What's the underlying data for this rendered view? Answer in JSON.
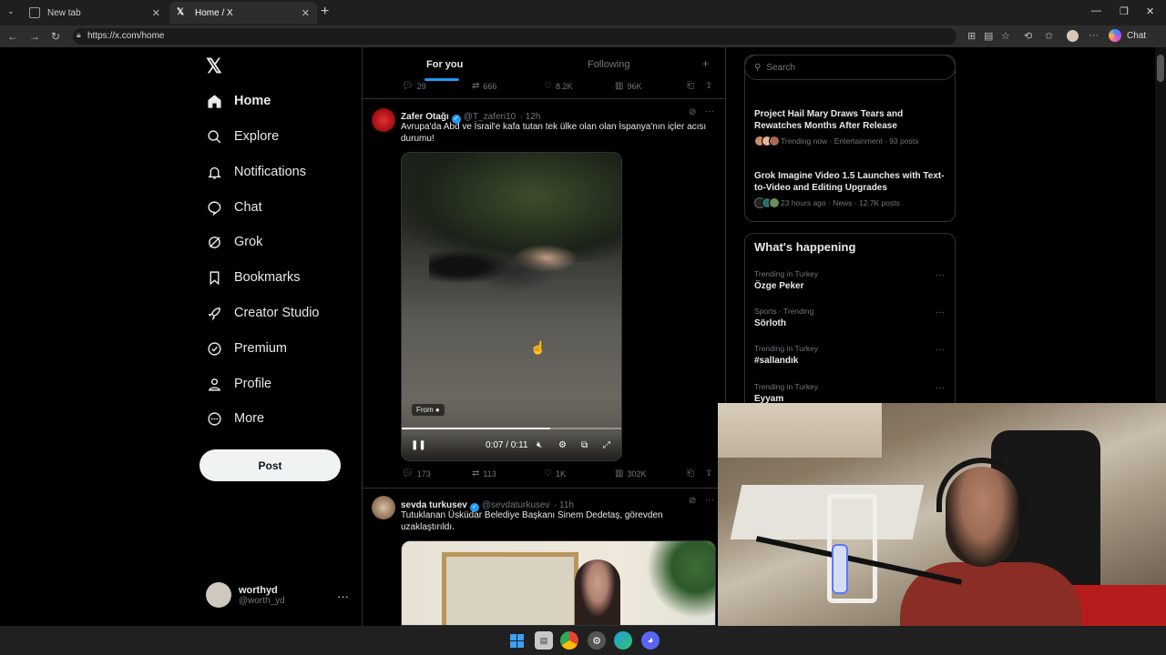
{
  "browser": {
    "tabs": [
      {
        "label": "New tab"
      },
      {
        "label": "Home / X"
      }
    ],
    "url": "https://x.com/home",
    "copilot_label": "Chat"
  },
  "sidebar": {
    "logo": "X",
    "items": [
      {
        "label": "Home",
        "icon": "home-icon"
      },
      {
        "label": "Explore",
        "icon": "search-icon"
      },
      {
        "label": "Notifications",
        "icon": "bell-icon"
      },
      {
        "label": "Chat",
        "icon": "chat-bubble-icon"
      },
      {
        "label": "Grok",
        "icon": "grok-icon"
      },
      {
        "label": "Bookmarks",
        "icon": "bookmark-icon"
      },
      {
        "label": "Creator Studio",
        "icon": "rocket-icon"
      },
      {
        "label": "Premium",
        "icon": "verified-icon"
      },
      {
        "label": "Profile",
        "icon": "person-icon"
      },
      {
        "label": "More",
        "icon": "more-circle-icon"
      }
    ],
    "post_label": "Post",
    "account": {
      "name": "worthyd",
      "handle": "@worth_yd",
      "more": "···"
    }
  },
  "feed": {
    "tabs": [
      {
        "label": "For you"
      },
      {
        "label": "Following"
      }
    ],
    "prev_tweet_actions": {
      "replies": "29",
      "reposts": "666",
      "likes": "8.2K",
      "views": "96K"
    },
    "tweet1": {
      "name": "Zafer Otağı",
      "handle": "@T_zaferi10",
      "time": "· 12h",
      "text": "Avrupa'da Abd ve İsrail'e kafa tutan tek ülke olan olan İspanya'nın içler acısı durumu!",
      "video": {
        "from_label": "From",
        "time": "0:07 / 0:11",
        "progress": 0.67
      },
      "actions": {
        "replies": "173",
        "reposts": "113",
        "likes": "1K",
        "views": "302K"
      }
    },
    "tweet2": {
      "name": "sevda turkusev",
      "handle": "@sevdaturkusev",
      "time": "· 11h",
      "text": "Tutuklanan Üsküdar Belediye Başkanı Sinem Dedetaş, görevden uzaklaştırıldı."
    }
  },
  "right": {
    "search_placeholder": "Search",
    "news": [
      {
        "title": "Project Hail Mary Draws Tears and Rewatches Months After Release",
        "meta": "Trending now · Entertainment · 93 posts"
      },
      {
        "title": "Grok Imagine Video 1.5 Launches with Text-to-Video and Editing Upgrades",
        "meta": "23 hours ago · News · 12.7K posts"
      }
    ],
    "happening_title": "What's happening",
    "trends": [
      {
        "context": "Trending in Turkey",
        "name": "Özge Peker"
      },
      {
        "context": "Sports · Trending",
        "name": "Sörloth"
      },
      {
        "context": "Trending in Turkey",
        "name": "#sallandık"
      },
      {
        "context": "Trending in Turkey",
        "name": "Eyyam"
      }
    ]
  },
  "colors": {
    "accent": "#1d9bf0",
    "bg": "#000000",
    "border": "#2f3336",
    "muted": "#71767b"
  }
}
